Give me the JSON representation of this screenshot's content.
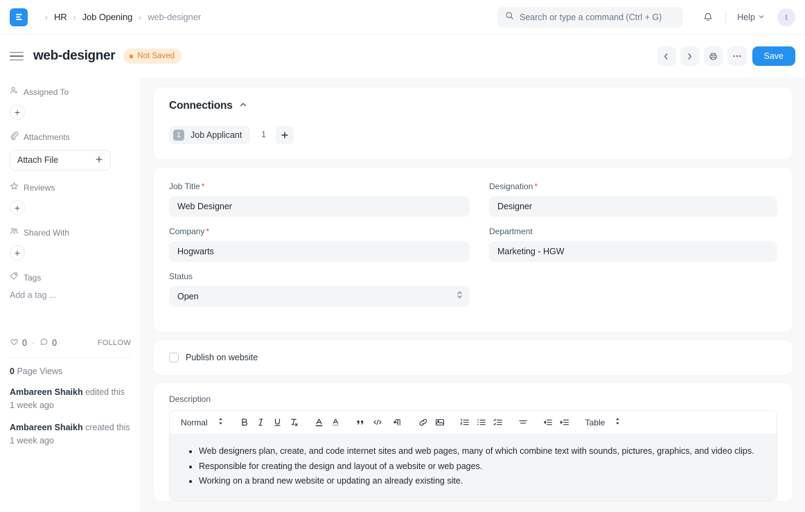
{
  "navbar": {
    "logo_icon": "erpnext-logo-icon",
    "breadcrumb": [
      {
        "label": "HR",
        "current": false
      },
      {
        "label": "Job Opening",
        "current": false
      },
      {
        "label": "web-designer",
        "current": true
      }
    ],
    "search": {
      "icon": "search-icon",
      "placeholder": "Search or type a command (Ctrl + G)",
      "value": ""
    },
    "notification_icon": "bell-icon",
    "help_label": "Help",
    "help_caret_icon": "chevron-down-icon",
    "avatar_initial": "t"
  },
  "page_head": {
    "menu_icon": "hamburger-menu-icon",
    "title": "web-designer",
    "status_badge": "Not Saved",
    "prev_icon": "chevron-left-icon",
    "next_icon": "chevron-right-icon",
    "print_icon": "printer-icon",
    "more_icon": "ellipsis-icon",
    "save_label": "Save"
  },
  "sidebar": {
    "sections": [
      {
        "icon": "assigned-user-icon",
        "label": "Assigned To",
        "control": "add-round"
      },
      {
        "icon": "paperclip-icon",
        "label": "Attachments",
        "control": "attach-file"
      },
      {
        "icon": "star-icon",
        "label": "Reviews",
        "control": "add-round"
      },
      {
        "icon": "shared-users-icon",
        "label": "Shared With",
        "control": "add-round"
      },
      {
        "icon": "tag-icon",
        "label": "Tags",
        "control": "tag-input"
      }
    ],
    "attach_file_label": "Attach File",
    "tag_placeholder": "Add a tag ...",
    "like_icon": "heart-icon",
    "like_count": "0",
    "comment_icon": "comment-icon",
    "comment_count": "0",
    "follow_label": "FOLLOW",
    "page_views_count": "0",
    "page_views_label": "Page Views",
    "activity": [
      {
        "user": "Ambareen Shaikh",
        "action": " edited this",
        "time": "1 week ago"
      },
      {
        "user": "Ambareen Shaikh",
        "action": " created this",
        "time": "1 week ago"
      }
    ]
  },
  "connections": {
    "title": "Connections",
    "collapse_icon": "chevron-up-icon",
    "items": [
      {
        "count": "1",
        "label": "Job Applicant"
      }
    ],
    "trailing_number": "1",
    "add_icon": "plus-icon"
  },
  "form": {
    "fields": [
      {
        "label": "Job Title",
        "required": true,
        "value": "Web Designer",
        "type": "text"
      },
      {
        "label": "Designation",
        "required": true,
        "value": "Designer",
        "type": "text"
      },
      {
        "label": "Company",
        "required": true,
        "value": "Hogwarts",
        "type": "text"
      },
      {
        "label": "Department",
        "required": false,
        "value": "Marketing - HGW",
        "type": "text"
      },
      {
        "label": "Status",
        "required": false,
        "value": "Open",
        "type": "select"
      }
    ],
    "required_mark": "*",
    "select_arrows_icon": "select-updown-icon"
  },
  "publish": {
    "checkbox_label": "Publish on website",
    "checked": false
  },
  "description": {
    "label": "Description",
    "toolbar": {
      "style_select": "Normal",
      "style_arrows_icon": "select-updown-icon",
      "buttons": [
        "bold-icon",
        "italic-icon",
        "underline-icon",
        "clear-format-icon",
        "font-color-icon",
        "highlight-icon",
        "blockquote-icon",
        "code-icon",
        "paragraph-direction-icon",
        "link-icon",
        "image-icon",
        "ordered-list-icon",
        "bullet-list-icon",
        "checklist-icon",
        "align-icon",
        "outdent-icon",
        "indent-icon"
      ],
      "table_label": "Table",
      "table_arrows_icon": "select-updown-icon"
    },
    "bullets": [
      "Web designers plan, create, and code internet sites and web pages, many of which combine text with sounds, pictures, graphics, and video clips.",
      "Responsible for creating the design and layout of a website or web pages.",
      "Working on a brand new website or updating an already existing site."
    ]
  },
  "colors": {
    "accent": "#2490ef",
    "unsaved_bg": "#fdedd9",
    "unsaved_text": "#e8792a",
    "required": "#e24c4c",
    "page_bg": "#f8f8f8",
    "control_bg": "#f4f5f6"
  }
}
